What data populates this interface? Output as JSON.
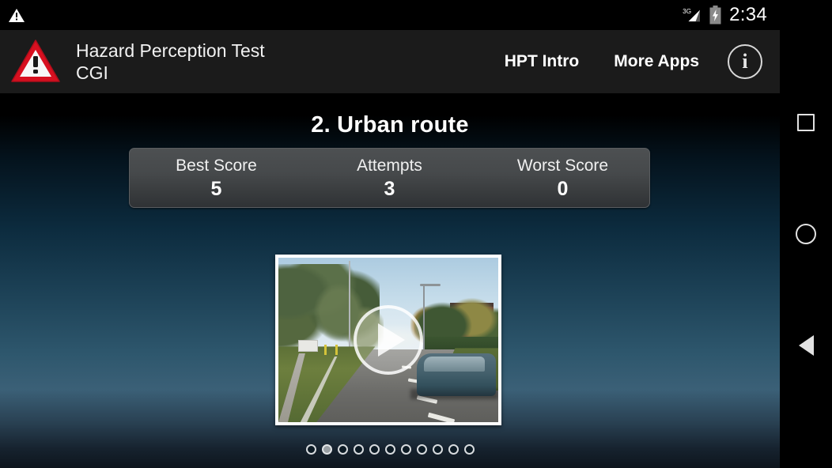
{
  "statusbar": {
    "notification_icon": "warning-triangle-icon",
    "network_label": "3G",
    "signal_icon": "signal-bars-icon",
    "battery_icon": "battery-charging-icon",
    "clock": "2:34"
  },
  "appbar": {
    "logo_icon": "hazard-warning-triangle-logo",
    "title": "Hazard Perception Test",
    "subtitle": "CGI",
    "actions": [
      {
        "label": "HPT Intro",
        "name": "hpt-intro-button"
      },
      {
        "label": "More Apps",
        "name": "more-apps-button"
      }
    ],
    "info_icon_label": "i",
    "info_icon": "info-circle-icon"
  },
  "main": {
    "level_title": "2. Urban route",
    "stats": [
      {
        "label": "Best Score",
        "value": "5"
      },
      {
        "label": "Attempts",
        "value": "3"
      },
      {
        "label": "Worst Score",
        "value": "0"
      }
    ],
    "video": {
      "name": "urban-route-video-thumbnail",
      "play_icon": "play-triangle-icon",
      "scene_description": "CGI urban road with trees, street lamp, oncoming car"
    },
    "pager": {
      "total_dots": 11,
      "active_index": 1
    }
  },
  "navbar": {
    "recents_icon": "square-overview-icon",
    "home_icon": "circle-home-icon",
    "back_icon": "triangle-back-icon"
  },
  "colors": {
    "accent_red": "#cc0000",
    "appbar_bg": "#1b1b1b",
    "panel_top": "#4d5052",
    "panel_bottom": "#2f3235",
    "wallpaper_mid": "#3b6077"
  }
}
